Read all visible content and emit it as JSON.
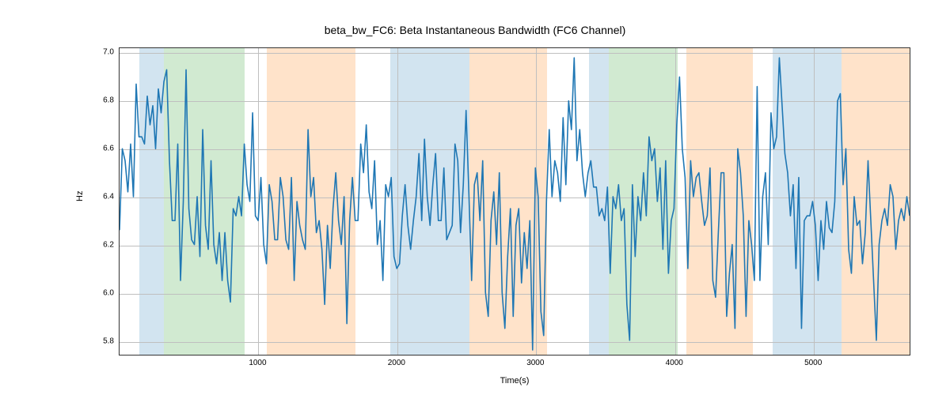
{
  "chart_data": {
    "type": "line",
    "title": "beta_bw_FC6: Beta Instantaneous Bandwidth (FC6 Channel)",
    "xlabel": "Time(s)",
    "ylabel": "Hz",
    "xlim": [
      0,
      5700
    ],
    "ylim": [
      5.74,
      7.02
    ],
    "xticks": [
      1000,
      2000,
      3000,
      4000,
      5000
    ],
    "yticks": [
      5.8,
      6.0,
      6.2,
      6.4,
      6.6,
      6.8,
      7.0
    ],
    "shaded_regions": [
      {
        "x0": 140,
        "x1": 320,
        "color": "blue"
      },
      {
        "x0": 320,
        "x1": 900,
        "color": "green"
      },
      {
        "x0": 1060,
        "x1": 1700,
        "color": "orange"
      },
      {
        "x0": 1950,
        "x1": 2520,
        "color": "blue"
      },
      {
        "x0": 2520,
        "x1": 3080,
        "color": "orange"
      },
      {
        "x0": 3380,
        "x1": 3520,
        "color": "blue"
      },
      {
        "x0": 3520,
        "x1": 4020,
        "color": "green"
      },
      {
        "x0": 4080,
        "x1": 4560,
        "color": "orange"
      },
      {
        "x0": 4700,
        "x1": 5200,
        "color": "blue"
      },
      {
        "x0": 5200,
        "x1": 5700,
        "color": "orange"
      }
    ],
    "x": [
      0,
      20,
      40,
      60,
      80,
      100,
      120,
      140,
      160,
      180,
      200,
      220,
      240,
      260,
      280,
      300,
      320,
      340,
      360,
      380,
      400,
      420,
      440,
      460,
      480,
      500,
      520,
      540,
      560,
      580,
      600,
      620,
      640,
      660,
      680,
      700,
      720,
      740,
      760,
      780,
      800,
      820,
      840,
      860,
      880,
      900,
      920,
      940,
      960,
      980,
      1000,
      1020,
      1040,
      1060,
      1080,
      1100,
      1120,
      1140,
      1160,
      1180,
      1200,
      1220,
      1240,
      1260,
      1280,
      1300,
      1320,
      1340,
      1360,
      1380,
      1400,
      1420,
      1440,
      1460,
      1480,
      1500,
      1520,
      1540,
      1560,
      1580,
      1600,
      1620,
      1640,
      1660,
      1680,
      1700,
      1720,
      1740,
      1760,
      1780,
      1800,
      1820,
      1840,
      1860,
      1880,
      1900,
      1920,
      1940,
      1960,
      1980,
      2000,
      2020,
      2040,
      2060,
      2080,
      2100,
      2120,
      2140,
      2160,
      2180,
      2200,
      2220,
      2240,
      2260,
      2280,
      2300,
      2320,
      2340,
      2360,
      2380,
      2400,
      2420,
      2440,
      2460,
      2480,
      2500,
      2520,
      2540,
      2560,
      2580,
      2600,
      2620,
      2640,
      2660,
      2680,
      2700,
      2720,
      2740,
      2760,
      2780,
      2800,
      2820,
      2840,
      2860,
      2880,
      2900,
      2920,
      2940,
      2960,
      2980,
      3000,
      3020,
      3040,
      3060,
      3080,
      3100,
      3120,
      3140,
      3160,
      3180,
      3200,
      3220,
      3240,
      3260,
      3280,
      3300,
      3320,
      3340,
      3360,
      3380,
      3400,
      3420,
      3440,
      3460,
      3480,
      3500,
      3520,
      3540,
      3560,
      3580,
      3600,
      3620,
      3640,
      3660,
      3680,
      3700,
      3720,
      3740,
      3760,
      3780,
      3800,
      3820,
      3840,
      3860,
      3880,
      3900,
      3920,
      3940,
      3960,
      3980,
      4000,
      4020,
      4040,
      4060,
      4080,
      4100,
      4120,
      4140,
      4160,
      4180,
      4200,
      4220,
      4240,
      4260,
      4280,
      4300,
      4320,
      4340,
      4360,
      4380,
      4400,
      4420,
      4440,
      4460,
      4480,
      4500,
      4520,
      4540,
      4560,
      4580,
      4600,
      4620,
      4640,
      4660,
      4680,
      4700,
      4720,
      4740,
      4760,
      4780,
      4800,
      4820,
      4840,
      4860,
      4880,
      4900,
      4920,
      4940,
      4960,
      4980,
      5000,
      5020,
      5040,
      5060,
      5080,
      5100,
      5120,
      5140,
      5160,
      5180,
      5200,
      5220,
      5240,
      5260,
      5280,
      5300,
      5320,
      5340,
      5360,
      5380,
      5400,
      5420,
      5440,
      5460,
      5480,
      5500,
      5520,
      5540,
      5560,
      5580,
      5600,
      5620,
      5640,
      5660,
      5680,
      5700
    ],
    "y": [
      6.26,
      6.6,
      6.55,
      6.42,
      6.62,
      6.4,
      6.87,
      6.65,
      6.65,
      6.62,
      6.82,
      6.7,
      6.78,
      6.6,
      6.85,
      6.75,
      6.88,
      6.93,
      6.55,
      6.3,
      6.3,
      6.62,
      6.05,
      6.38,
      6.93,
      6.35,
      6.22,
      6.2,
      6.4,
      6.15,
      6.68,
      6.28,
      6.18,
      6.55,
      6.2,
      6.12,
      6.25,
      6.05,
      6.25,
      6.05,
      5.96,
      6.35,
      6.32,
      6.4,
      6.32,
      6.62,
      6.45,
      6.38,
      6.75,
      6.32,
      6.3,
      6.48,
      6.2,
      6.12,
      6.45,
      6.38,
      6.22,
      6.22,
      6.48,
      6.4,
      6.22,
      6.18,
      6.48,
      6.05,
      6.38,
      6.28,
      6.22,
      6.18,
      6.68,
      6.4,
      6.48,
      6.25,
      6.3,
      6.18,
      5.95,
      6.28,
      6.1,
      6.35,
      6.5,
      6.3,
      6.2,
      6.4,
      5.87,
      6.3,
      6.48,
      6.3,
      6.3,
      6.62,
      6.5,
      6.7,
      6.42,
      6.35,
      6.55,
      6.2,
      6.3,
      6.05,
      6.45,
      6.4,
      6.48,
      6.15,
      6.1,
      6.12,
      6.32,
      6.45,
      6.28,
      6.18,
      6.3,
      6.4,
      6.58,
      6.3,
      6.64,
      6.4,
      6.28,
      6.45,
      6.58,
      6.3,
      6.3,
      6.52,
      6.22,
      6.25,
      6.28,
      6.62,
      6.55,
      6.25,
      6.45,
      6.76,
      6.42,
      6.05,
      6.45,
      6.5,
      6.3,
      6.55,
      6.0,
      5.9,
      6.3,
      6.42,
      6.2,
      6.5,
      6.0,
      5.85,
      6.15,
      6.35,
      5.9,
      6.28,
      6.35,
      6.04,
      6.25,
      6.1,
      6.3,
      5.76,
      6.52,
      6.4,
      5.92,
      5.82,
      6.38,
      6.68,
      6.4,
      6.55,
      6.5,
      6.38,
      6.73,
      6.45,
      6.8,
      6.68,
      6.98,
      6.55,
      6.68,
      6.5,
      6.4,
      6.5,
      6.55,
      6.44,
      6.44,
      6.32,
      6.35,
      6.3,
      6.44,
      6.08,
      6.4,
      6.35,
      6.45,
      6.3,
      6.35,
      5.95,
      5.8,
      6.45,
      6.15,
      6.4,
      6.3,
      6.5,
      6.32,
      6.65,
      6.55,
      6.6,
      6.38,
      6.52,
      6.18,
      6.55,
      6.08,
      6.3,
      6.35,
      6.7,
      6.9,
      6.6,
      6.48,
      6.1,
      6.55,
      6.4,
      6.48,
      6.5,
      6.38,
      6.28,
      6.32,
      6.52,
      6.05,
      5.98,
      6.25,
      6.5,
      6.5,
      5.9,
      6.08,
      6.2,
      5.85,
      6.6,
      6.5,
      6.32,
      5.9,
      6.3,
      6.2,
      6.05,
      6.86,
      6.05,
      6.4,
      6.5,
      6.2,
      6.75,
      6.6,
      6.65,
      6.98,
      6.78,
      6.58,
      6.5,
      6.32,
      6.45,
      6.1,
      6.48,
      5.85,
      6.3,
      6.32,
      6.32,
      6.38,
      6.28,
      6.05,
      6.3,
      6.18,
      6.38,
      6.27,
      6.25,
      6.38,
      6.8,
      6.83,
      6.45,
      6.6,
      6.18,
      6.08,
      6.4,
      6.28,
      6.3,
      6.12,
      6.25,
      6.55,
      6.3,
      6.05,
      5.8,
      6.2,
      6.3,
      6.35,
      6.28,
      6.45,
      6.4,
      6.18,
      6.3,
      6.35,
      6.3,
      6.4,
      6.32
    ]
  }
}
